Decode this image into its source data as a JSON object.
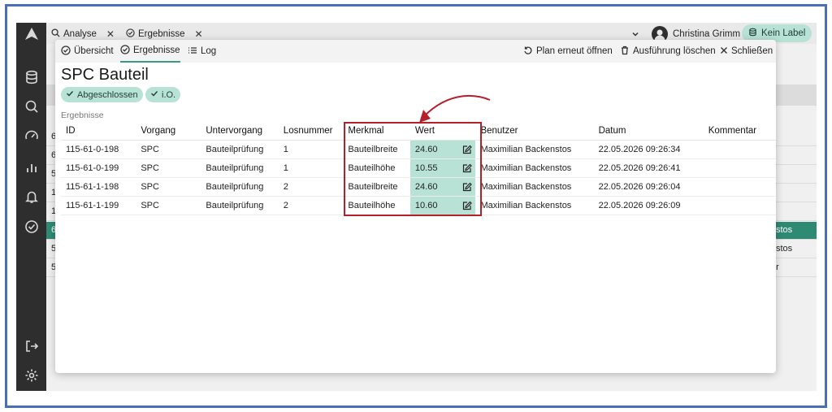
{
  "colors": {
    "accent": "#b8e2d6",
    "accent_dark": "#3a9a86",
    "sidebar": "#2e2e2e",
    "highlight": "#b5202b",
    "frame": "#4a6fb5"
  },
  "top_tabs": [
    {
      "label": "Analyse",
      "icon": "search-icon"
    },
    {
      "label": "Ergebnisse",
      "icon": "check-circle-icon"
    }
  ],
  "user": {
    "name": "Christina Grimm"
  },
  "label_pill": {
    "label": "Kein Label"
  },
  "sidebar_icons": [
    "logo-icon",
    "database-icon",
    "search-icon",
    "gauge-icon",
    "chart-icon",
    "bell-icon",
    "check-circle-icon",
    "logout-icon",
    "settings-icon"
  ],
  "background_rows": [
    {
      "id": "6",
      "user": ""
    },
    {
      "id": "6",
      "user": ""
    },
    {
      "id": "5",
      "user": ""
    },
    {
      "id": "1",
      "user": ""
    },
    {
      "id": "1",
      "user": ""
    },
    {
      "id": "6",
      "user": "stos"
    },
    {
      "id": "5",
      "user": "stos"
    },
    {
      "id": "5",
      "user": "r"
    }
  ],
  "modal": {
    "tabs": [
      {
        "label": "Übersicht",
        "icon": "check-circle-icon"
      },
      {
        "label": "Ergebnisse",
        "icon": "check-circle-icon"
      },
      {
        "label": "Log",
        "icon": "list-icon"
      }
    ],
    "actions": [
      {
        "label": "Plan erneut öffnen",
        "icon": "reopen-icon"
      },
      {
        "label": "Ausführung löschen",
        "icon": "trash-icon"
      },
      {
        "label": "Schließen",
        "icon": "close-icon"
      }
    ],
    "title": "SPC Bauteil",
    "badges": [
      {
        "label": "Abgeschlossen",
        "icon": "check-icon"
      },
      {
        "label": "i.O.",
        "icon": "check-icon"
      }
    ],
    "section_label": "Ergebnisse",
    "table": {
      "headers": [
        "ID",
        "Vorgang",
        "Untervorgang",
        "Losnummer",
        "Merkmal",
        "Wert",
        "Benutzer",
        "Datum",
        "Kommentar"
      ],
      "rows": [
        [
          "115-61-0-198",
          "SPC",
          "Bauteilprüfung",
          "1",
          "Bauteilbreite",
          "24.60",
          "Maximilian Backenstos",
          "22.05.2026 09:26:34",
          ""
        ],
        [
          "115-61-0-199",
          "SPC",
          "Bauteilprüfung",
          "1",
          "Bauteilhöhe",
          "10.55",
          "Maximilian Backenstos",
          "22.05.2026 09:26:41",
          ""
        ],
        [
          "115-61-1-198",
          "SPC",
          "Bauteilprüfung",
          "2",
          "Bauteilbreite",
          "24.60",
          "Maximilian Backenstos",
          "22.05.2026 09:26:04",
          ""
        ],
        [
          "115-61-1-199",
          "SPC",
          "Bauteilprüfung",
          "2",
          "Bauteilhöhe",
          "10.60",
          "Maximilian Backenstos",
          "22.05.2026 09:26:09",
          ""
        ]
      ]
    }
  }
}
